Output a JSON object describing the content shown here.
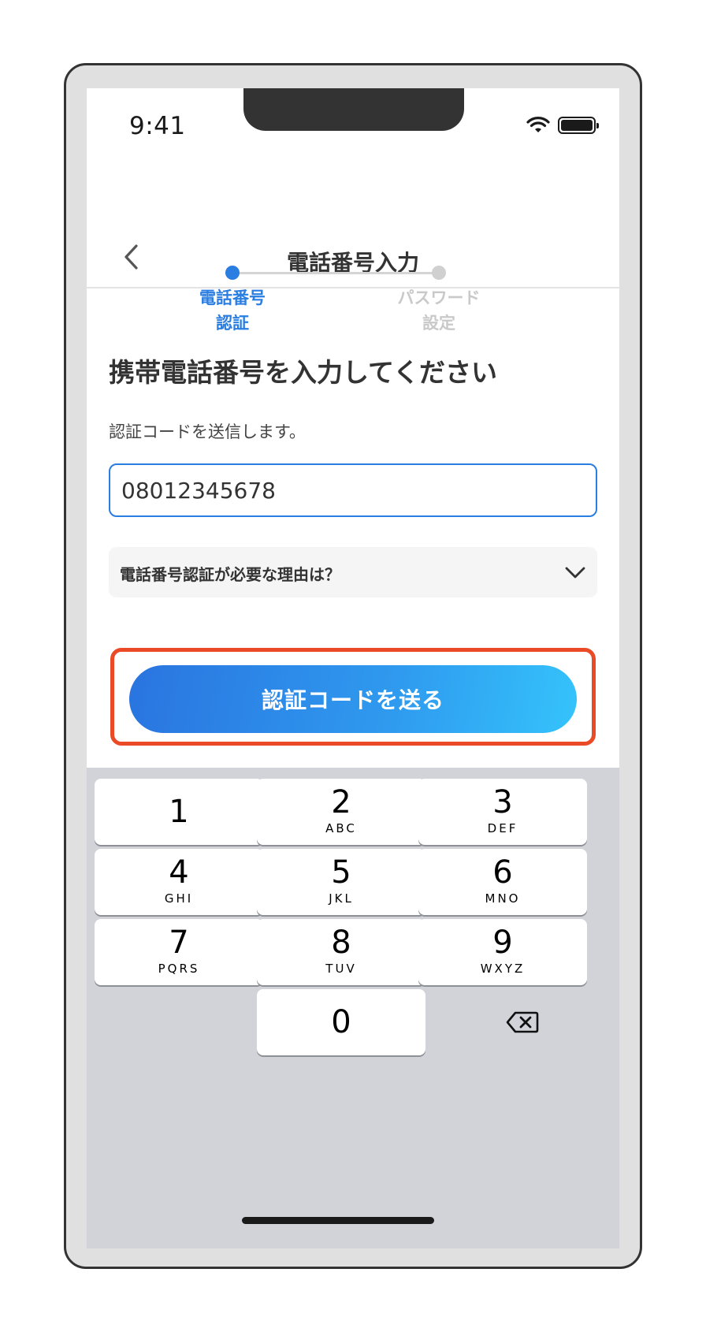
{
  "status_bar": {
    "time": "9:41",
    "wifi_icon": "wifi-icon",
    "battery_icon": "battery-icon"
  },
  "header": {
    "back_icon": "chevron-left-icon",
    "title": "電話番号入力"
  },
  "stepper": {
    "steps": [
      {
        "label_line1": "電話番号",
        "label_line2": "認証",
        "state": "active"
      },
      {
        "label_line1": "パスワード",
        "label_line2": "設定",
        "state": "inactive"
      }
    ]
  },
  "form": {
    "heading": "携帯電話番号を入力してください",
    "helper": "認証コードを送信します。",
    "phone_value": "08012345678",
    "faq_label": "電話番号認証が必要な理由は？",
    "faq_icon": "chevron-down-icon",
    "submit_label": "認証コードを送る"
  },
  "keypad": {
    "keys": [
      {
        "num": "1",
        "letters": ""
      },
      {
        "num": "2",
        "letters": "ABC"
      },
      {
        "num": "3",
        "letters": "DEF"
      },
      {
        "num": "4",
        "letters": "GHI"
      },
      {
        "num": "5",
        "letters": "JKL"
      },
      {
        "num": "6",
        "letters": "MNO"
      },
      {
        "num": "7",
        "letters": "PQRS"
      },
      {
        "num": "8",
        "letters": "TUV"
      },
      {
        "num": "9",
        "letters": "WXYZ"
      },
      {
        "num": "0",
        "letters": ""
      }
    ],
    "delete_icon": "backspace-icon"
  },
  "colors": {
    "accent": "#2a7de1",
    "highlight": "#ea4b26",
    "cta_gradient_start": "#2a74e0",
    "cta_gradient_end": "#35c3fb",
    "keyboard_bg": "#d1d3d9"
  }
}
